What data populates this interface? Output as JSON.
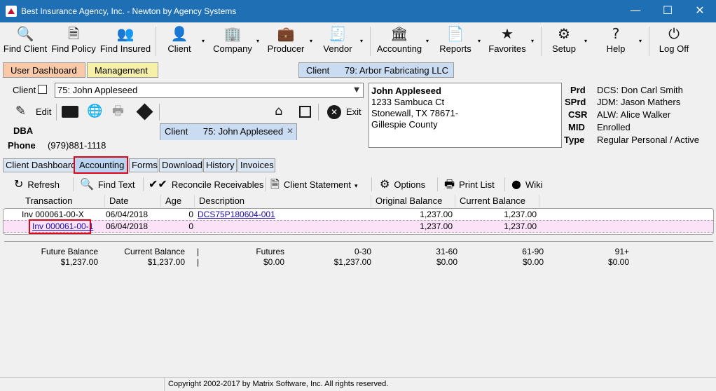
{
  "window": {
    "title": "Best Insurance Agency, Inc. -  Newton by Agency Systems",
    "minimize": "—",
    "maximize": "☐",
    "close": "✕"
  },
  "toolbar": {
    "items": [
      {
        "label": "Find Client",
        "icon": "search-icon",
        "glyph": "🔍"
      },
      {
        "label": "Find Policy",
        "icon": "policy-search-icon",
        "glyph": "🗎"
      },
      {
        "label": "Find Insured",
        "icon": "people-icon",
        "glyph": "👥"
      },
      {
        "label": "Client",
        "icon": "person-icon",
        "glyph": "👤"
      },
      {
        "label": "Company",
        "icon": "building-icon",
        "glyph": "🏢"
      },
      {
        "label": "Producer",
        "icon": "briefcase-icon",
        "glyph": "💼"
      },
      {
        "label": "Vendor",
        "icon": "receipt-icon",
        "glyph": "🧾"
      },
      {
        "label": "Accounting",
        "icon": "bank-icon",
        "glyph": "🏛"
      },
      {
        "label": "Reports",
        "icon": "report-icon",
        "glyph": "📄"
      },
      {
        "label": "Favorites",
        "icon": "star-icon",
        "glyph": "★"
      },
      {
        "label": "Setup",
        "icon": "gear-icon",
        "glyph": "⚙"
      },
      {
        "label": "Help",
        "icon": "help-icon",
        "glyph": "?"
      },
      {
        "label": "Log Off",
        "icon": "power-icon",
        "glyph": "⏻"
      }
    ],
    "dropdown_glyph": "▾"
  },
  "main_tabs": [
    {
      "label": "User Dashboard",
      "color": "#f9c9a8"
    },
    {
      "label": "Management",
      "color": "#f7f0a8"
    },
    {
      "label": "Client      75: John Appleseed",
      "color": "#c9dcf2",
      "active": true,
      "close": "✕"
    },
    {
      "label": "Client      79: Arbor Fabricating LLC",
      "color": "#c9dcf2"
    }
  ],
  "client": {
    "client_label": "Client",
    "selected": "75: John Appleseed",
    "edit_label": "Edit",
    "exit_label": "Exit",
    "dba_label": "DBA",
    "phone_label": "Phone",
    "phone_value": "(979)881-1118",
    "address": {
      "name": "John Appleseed",
      "line1": "1233 Sambuca Ct",
      "line2": "Stonewall, TX 78671-",
      "line3": "Gillespie County"
    },
    "info": [
      {
        "key": "Prd",
        "value": "DCS: Don Carl Smith"
      },
      {
        "key": "SPrd",
        "value": "JDM: Jason Mathers"
      },
      {
        "key": "CSR",
        "value": "ALW: Alice Walker"
      },
      {
        "key": "MID",
        "value": "Enrolled"
      },
      {
        "key": "Type",
        "value": "Regular Personal / Active"
      }
    ]
  },
  "sub_tabs": [
    "Client Dashboard",
    "Accounting",
    "Forms",
    "Download",
    "History",
    "Invoices"
  ],
  "accounting_toolbar": {
    "refresh": "Refresh",
    "find_text": "Find Text",
    "reconcile": "Reconcile Receivables",
    "statement": "Client Statement",
    "options": "Options",
    "print_list": "Print List",
    "wiki": "Wiki"
  },
  "grid": {
    "headers": [
      "Transaction",
      "Date",
      "Age",
      "Description",
      "Original Balance",
      "Current Balance"
    ],
    "rows": [
      {
        "transaction": "Inv 000061-00-X",
        "date": "06/04/2018",
        "age": "0",
        "description": "DCS75P180604-001",
        "original": "1,237.00",
        "current": "1,237.00"
      },
      {
        "transaction": "Inv 000061-00-1",
        "date": "06/04/2018",
        "age": "0",
        "description": "",
        "original": "1,237.00",
        "current": "1,237.00"
      }
    ]
  },
  "summary": {
    "labels": [
      "Future Balance",
      "Current Balance",
      "|",
      "Futures",
      "0-30",
      "31-60",
      "61-90",
      "91+"
    ],
    "values": [
      "$1,237.00",
      "$1,237.00",
      "|",
      "$0.00",
      "$1,237.00",
      "$0.00",
      "$0.00",
      "$0.00"
    ]
  },
  "status": {
    "copyright": "Copyright 2002-2017 by Matrix Software, Inc. All rights reserved."
  }
}
